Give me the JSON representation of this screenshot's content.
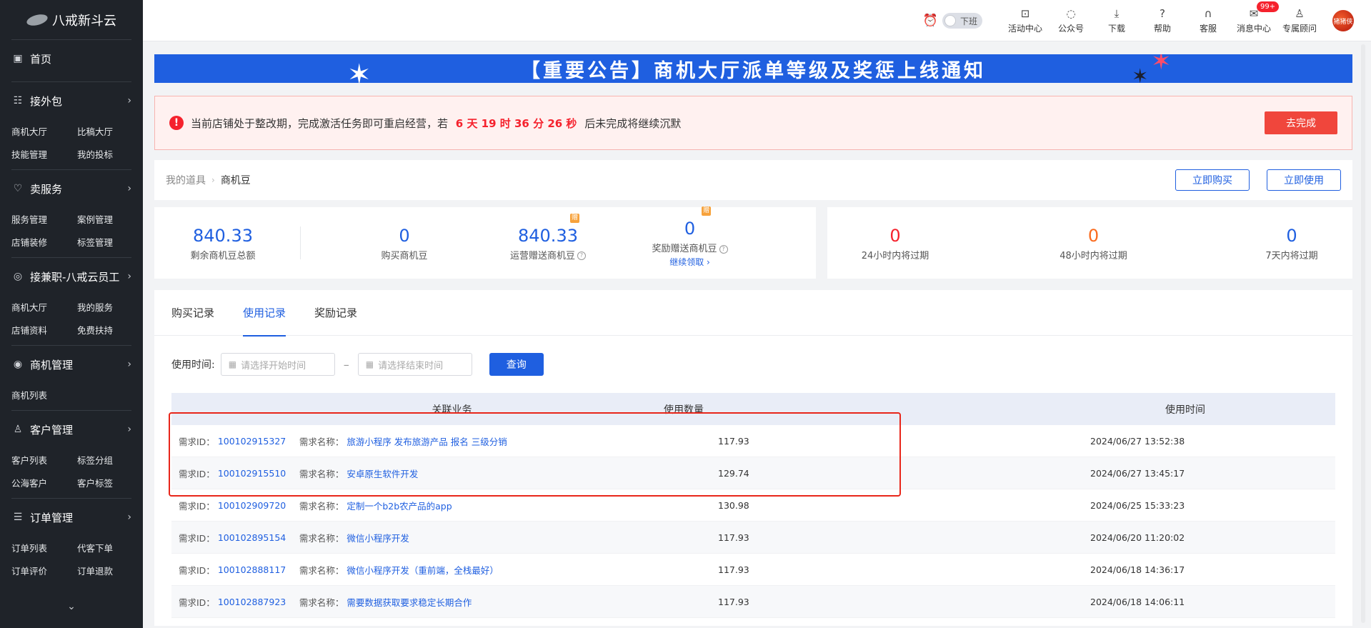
{
  "logo": {
    "text": "八戒新斗云"
  },
  "sidebar": {
    "groups": [
      {
        "title": "首页",
        "icon": "home-icon",
        "items": []
      },
      {
        "title": "接外包",
        "icon": "task-icon",
        "items": [
          "商机大厅",
          "比稿大厅",
          "技能管理",
          "我的投标"
        ]
      },
      {
        "title": "卖服务",
        "icon": "heart-icon",
        "items": [
          "服务管理",
          "案例管理",
          "店铺装修",
          "标签管理"
        ]
      },
      {
        "title": "接兼职-八戒云员工",
        "icon": "coin-icon",
        "items": [
          "商机大厅",
          "我的服务",
          "店铺资料",
          "免费扶持"
        ]
      },
      {
        "title": "商机管理",
        "icon": "target-icon",
        "items": [
          "商机列表"
        ]
      },
      {
        "title": "客户管理",
        "icon": "user-icon",
        "items": [
          "客户列表",
          "标签分组",
          "公海客户",
          "客户标签"
        ]
      },
      {
        "title": "订单管理",
        "icon": "doc-icon",
        "items": [
          "订单列表",
          "代客下单",
          "订单评价",
          "订单退款"
        ]
      }
    ],
    "more": "⌄"
  },
  "topbar": {
    "toggle_label": "下班",
    "items": [
      {
        "label": "活动中心",
        "icon": "gift-icon"
      },
      {
        "label": "公众号",
        "icon": "wechat-icon"
      },
      {
        "label": "下载",
        "icon": "download-icon"
      },
      {
        "label": "帮助",
        "icon": "help-icon"
      },
      {
        "label": "客服",
        "icon": "headset-icon"
      },
      {
        "label": "消息中心",
        "icon": "mail-icon",
        "badge": "99+"
      },
      {
        "label": "专属顾问",
        "icon": "advisor-icon"
      }
    ],
    "avatar_text": "猪猪侠"
  },
  "banner": {
    "text": "【重要公告】商机大厅派单等级及奖惩上线通知"
  },
  "alert": {
    "prefix": "当前店铺处于整改期，完成激活任务即可重启经营，若",
    "countdown": "6 天 19 时 36 分 26 秒",
    "suffix": "后未完成将继续沉默",
    "button": "去完成"
  },
  "breadcrumb": {
    "parent": "我的道具",
    "current": "商机豆"
  },
  "actions": {
    "buy": "立即购买",
    "use": "立即使用"
  },
  "stats": {
    "total": {
      "value": "840.33",
      "label": "剩余商机豆总额"
    },
    "bought": {
      "value": "0",
      "label": "购买商机豆"
    },
    "ops": {
      "value": "840.33",
      "label": "运营赠送商机豆"
    },
    "reward": {
      "value": "0",
      "label": "奖励赠送商机豆",
      "link": "继续领取 ›"
    },
    "exp24": {
      "value": "0",
      "label": "24小时内将过期"
    },
    "exp48": {
      "value": "0",
      "label": "48小时内将过期"
    },
    "exp7d": {
      "value": "0",
      "label": "7天内将过期"
    }
  },
  "tabs": [
    "购买记录",
    "使用记录",
    "奖励记录"
  ],
  "filter": {
    "label": "使用时间:",
    "start_placeholder": "请选择开始时间",
    "end_placeholder": "请选择结束时间",
    "dash": "–",
    "query": "查询"
  },
  "table": {
    "headers": [
      "关联业务",
      "使用数量",
      "使用时间"
    ],
    "id_key": "需求ID：",
    "name_key": "需求名称：",
    "rows": [
      {
        "id": "100102915327",
        "name": "旅游小程序 发布旅游产品 报名 三级分销",
        "qty": "117.93",
        "time": "2024/06/27 13:52:38"
      },
      {
        "id": "100102915510",
        "name": "安卓原生软件开发",
        "qty": "129.74",
        "time": "2024/06/27 13:45:17"
      },
      {
        "id": "100102909720",
        "name": "定制一个b2b农产品的app",
        "qty": "130.98",
        "time": "2024/06/25 15:33:23"
      },
      {
        "id": "100102895154",
        "name": "微信小程序开发",
        "qty": "117.93",
        "time": "2024/06/20 11:20:02"
      },
      {
        "id": "100102888117",
        "name": "微信小程序开发（重前端，全栈最好）",
        "qty": "117.93",
        "time": "2024/06/18 14:36:17"
      },
      {
        "id": "100102887923",
        "name": "需要数据获取要求稳定长期合作",
        "qty": "117.93",
        "time": "2024/06/18 14:06:11"
      }
    ]
  }
}
